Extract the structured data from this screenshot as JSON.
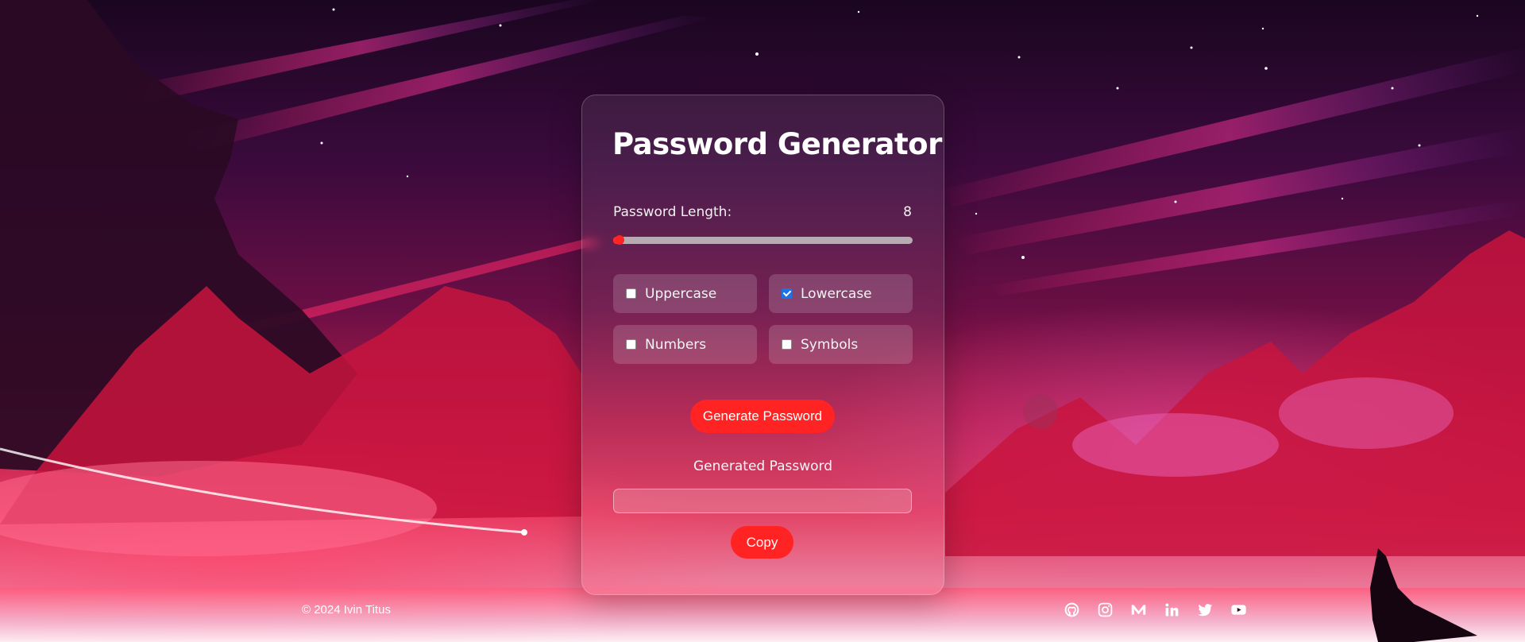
{
  "app": {
    "title": "Password Generator"
  },
  "length": {
    "label": "Password Length:",
    "value": "8",
    "slider_fraction": 0.02
  },
  "options": [
    {
      "label": "Uppercase",
      "checked": false
    },
    {
      "label": "Lowercase",
      "checked": true
    },
    {
      "label": "Numbers",
      "checked": false
    },
    {
      "label": "Symbols",
      "checked": false
    }
  ],
  "actions": {
    "generate_label": "Generate Password",
    "copy_label": "Copy"
  },
  "output": {
    "label": "Generated Password",
    "value": ""
  },
  "footer": {
    "copyright": "© 2024 Ivin Titus",
    "socials": [
      "github-icon",
      "instagram-icon",
      "medium-icon",
      "linkedin-icon",
      "twitter-icon",
      "youtube-icon"
    ]
  },
  "colors": {
    "accent": "#ff2323",
    "checkbox_checked": "#1a73e8",
    "text": "#ffffff"
  }
}
